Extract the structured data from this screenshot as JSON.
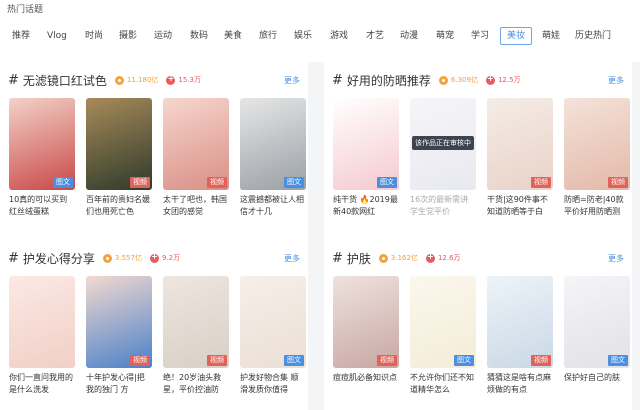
{
  "header": {
    "title": "热门话题"
  },
  "tabs": [
    {
      "label": "推荐",
      "active": false
    },
    {
      "label": "Vlog",
      "active": false
    },
    {
      "label": "时尚",
      "active": false
    },
    {
      "label": "摄影",
      "active": false
    },
    {
      "label": "运动",
      "active": false
    },
    {
      "label": "数码",
      "active": false
    },
    {
      "label": "美食",
      "active": false
    },
    {
      "label": "旅行",
      "active": false
    },
    {
      "label": "娱乐",
      "active": false
    },
    {
      "label": "游戏",
      "active": false
    },
    {
      "label": "才艺",
      "active": false
    },
    {
      "label": "动漫",
      "active": false
    },
    {
      "label": "萌宠",
      "active": false
    },
    {
      "label": "学习",
      "active": false
    },
    {
      "label": "美妆",
      "active": true
    },
    {
      "label": "萌娃",
      "active": false
    },
    {
      "label": "历史热门",
      "active": false
    }
  ],
  "more_label": "更多",
  "cards": [
    {
      "title": "无滤镜口红试色",
      "heat": "11.180亿",
      "growth": "15.3万",
      "items": [
        {
          "badge": "图文",
          "caption": "10真的可以买到红丝绒蛋糕",
          "colors": [
            "#c94848",
            "#f3d2c8"
          ]
        },
        {
          "badge": "视频",
          "caption": "百年前的贵妇名媛们也用死亡色",
          "colors": [
            "#2e3a2a",
            "#a88a5a"
          ]
        },
        {
          "badge": "视频",
          "caption": "太干了吧也，韩国女团的感觉",
          "colors": [
            "#d98f86",
            "#f6d6cd"
          ]
        },
        {
          "badge": "图文",
          "caption": "这震撼都被让人相信才十几",
          "colors": [
            "#9aa0a6",
            "#e6e6e6"
          ]
        }
      ]
    },
    {
      "title": "好用的防晒推荐",
      "heat": "6.309亿",
      "growth": "12.5万",
      "items": [
        {
          "badge": "图文",
          "caption": "纯干货 🔥2019最新40款网红",
          "colors": [
            "#f5c9cf",
            "#ffffff"
          ]
        },
        {
          "badge": "",
          "caption": "16次的最新需讲 学生党平价",
          "gray": true,
          "overlay": "该作品正在审核中",
          "colors": [
            "#e8e8f0",
            "#f6f6f8"
          ]
        },
        {
          "badge": "视频",
          "caption": "干货|这90件事不知道防晒等于白",
          "colors": [
            "#e9d2c8",
            "#f5ece6"
          ]
        },
        {
          "badge": "视频",
          "caption": "防晒=防老|40款平价好用防晒测",
          "colors": [
            "#e3b9a8",
            "#f4e2da"
          ]
        }
      ]
    },
    {
      "title": "护发心得分享",
      "heat": "3.557亿",
      "growth": "9.2万",
      "items": [
        {
          "badge": "",
          "caption": "你们一直问我用的是什么洗发",
          "colors": [
            "#f1cfc6",
            "#fbe9e4"
          ]
        },
        {
          "badge": "视频",
          "caption": "十年护发心得|把我的独门 方",
          "colors": [
            "#4a80c8",
            "#f2d9d0"
          ]
        },
        {
          "badge": "视频",
          "caption": "绝！20岁油头救星，平价控油防",
          "colors": [
            "#d8cfc6",
            "#eee6df"
          ]
        },
        {
          "badge": "图文",
          "caption": "护发好物合集 顺滑发质你值得",
          "colors": [
            "#eadfd6",
            "#f6efe8"
          ]
        }
      ]
    },
    {
      "title": "护肤",
      "heat": "3.162亿",
      "growth": "12.6万",
      "items": [
        {
          "badge": "视频",
          "caption": "痘痘肌必备知识点",
          "colors": [
            "#c7a7a2",
            "#efe2df"
          ]
        },
        {
          "badge": "图文",
          "caption": "不允许你们还不知道精华怎么",
          "colors": [
            "#f3ecd8",
            "#fbf7ec"
          ]
        },
        {
          "badge": "视频",
          "caption": "猜猜这是啥有点麻烦做的有点",
          "colors": [
            "#c9d8e6",
            "#eef3f8"
          ]
        },
        {
          "badge": "图文",
          "caption": "保护好自己的肤",
          "colors": [
            "#e1e1e6",
            "#f5f5f8"
          ]
        }
      ]
    }
  ]
}
